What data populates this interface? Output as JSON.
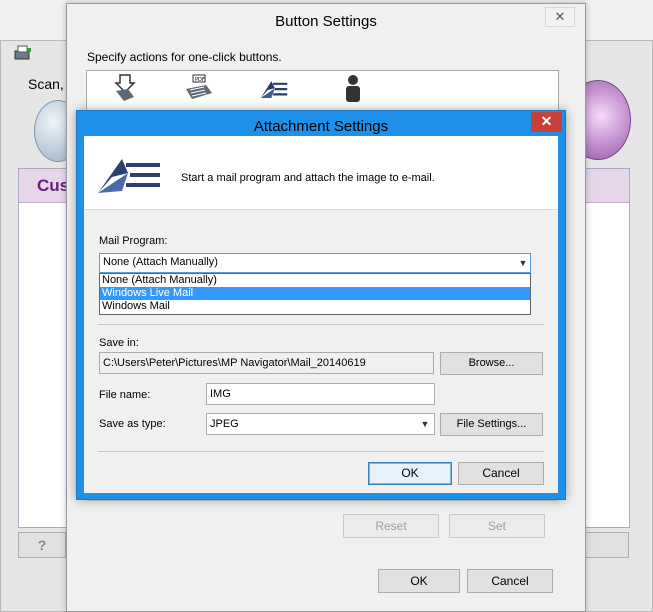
{
  "background_window": {
    "scan_label": "Scan,",
    "custom_label": "Cus",
    "help_button": "?"
  },
  "button_settings": {
    "title": "Button Settings",
    "close_glyph": "✕",
    "description": "Specify actions for one-click buttons.",
    "icons": [
      "save-to-pc-icon",
      "pdf-icon",
      "mail-icon",
      "person-icon"
    ],
    "reset_label": "Reset",
    "set_label": "Set",
    "ok_label": "OK",
    "cancel_label": "Cancel"
  },
  "attachment_settings": {
    "title": "Attachment Settings",
    "close_glyph": "✕",
    "banner_text": "Start a mail program and attach the image to e-mail.",
    "mail_program_label": "Mail Program:",
    "mail_program_value": "None (Attach Manually)",
    "mail_program_options": [
      "None (Attach Manually)",
      "Windows Live Mail",
      "Windows Mail"
    ],
    "highlighted_option": "Windows Live Mail",
    "save_in_label": "Save in:",
    "save_in_value": "C:\\Users\\Peter\\Pictures\\MP Navigator\\Mail_20140619",
    "browse_label": "Browse...",
    "file_name_label": "File name:",
    "file_name_value": "IMG",
    "save_as_type_label": "Save as type:",
    "save_as_type_value": "JPEG",
    "file_settings_label": "File Settings...",
    "ok_label": "OK",
    "cancel_label": "Cancel"
  },
  "colors": {
    "dialog_frame": "#1e90e8",
    "close_button": "#c7413a",
    "selection": "#3399ff",
    "accent_purple": "#6a1f80"
  }
}
